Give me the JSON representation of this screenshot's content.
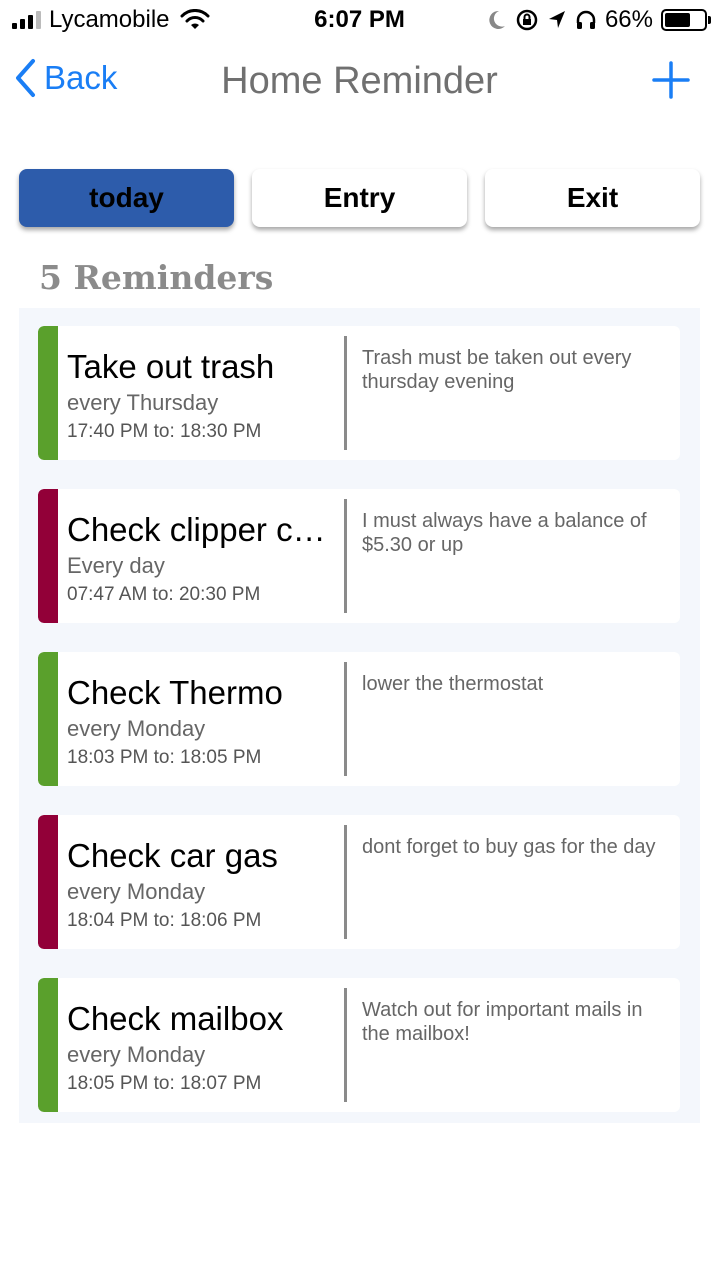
{
  "status_bar": {
    "carrier": "Lycamobile",
    "time": "6:07 PM",
    "battery_percent": "66%",
    "battery_level": 0.66
  },
  "nav": {
    "back_label": "Back",
    "title": "Home Reminder",
    "add_icon": "plus-icon"
  },
  "tabs": [
    {
      "label": "today",
      "active": true
    },
    {
      "label": "Entry",
      "active": false
    },
    {
      "label": "Exit",
      "active": false
    }
  ],
  "colors": {
    "accent": "#1a7ef5",
    "active_tab": "#2d5cab",
    "green": "#5aa02c",
    "maroon": "#920038"
  },
  "reminder_count_label": "5 Reminders",
  "reminders": [
    {
      "title": "Take out trash",
      "schedule": "every  Thursday",
      "time": "17:40 PM to: 18:30 PM",
      "note": "Trash must be taken out every thursday evening",
      "color": "#5aa02c"
    },
    {
      "title": "Check clipper card",
      "schedule": "Every day",
      "time": "07:47 AM to: 20:30 PM",
      "note": "I must always have a balance of $5.30 or up",
      "color": "#920038"
    },
    {
      "title": "Check Thermo",
      "schedule": "every  Monday",
      "time": "18:03 PM to: 18:05 PM",
      "note": "lower the thermostat",
      "color": "#5aa02c"
    },
    {
      "title": "Check car gas",
      "schedule": "every  Monday",
      "time": "18:04 PM to: 18:06 PM",
      "note": "dont forget to buy gas for the day",
      "color": "#920038"
    },
    {
      "title": "Check mailbox",
      "schedule": "every  Monday",
      "time": "18:05 PM to: 18:07 PM",
      "note": "Watch out for important mails in the mailbox!",
      "color": "#5aa02c"
    }
  ]
}
